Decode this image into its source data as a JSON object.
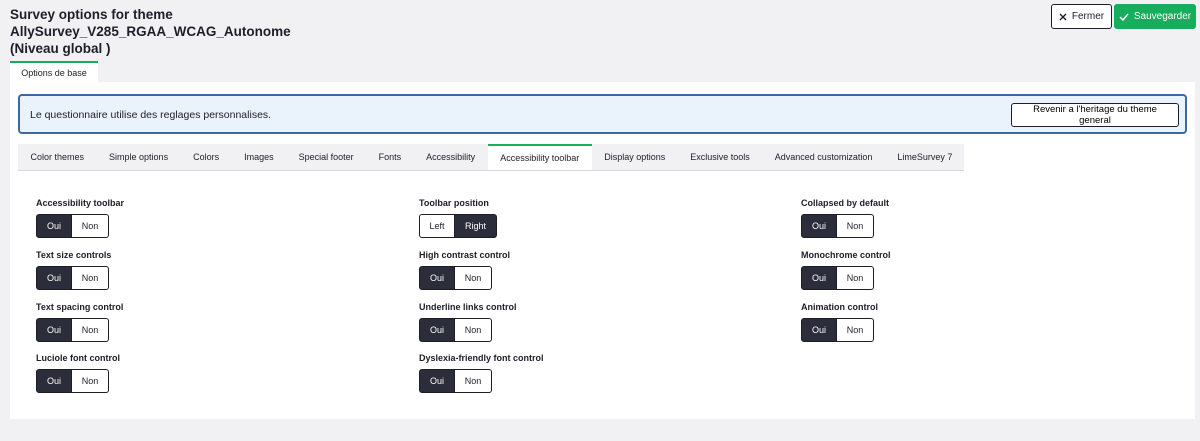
{
  "header": {
    "title_line1": "Survey options for theme",
    "title_line2": "AllySurvey_V285_RGAA_WCAG_Autonome",
    "title_line3": "(Niveau global )",
    "close_label": "Fermer",
    "save_label": "Sauvegarder"
  },
  "base_tab": "Options de base",
  "notice": {
    "text": "Le questionnaire utilise des reglages personnalises.",
    "revert_label": "Revenir a l'heritage du theme general"
  },
  "tabs": [
    {
      "label": "Color themes"
    },
    {
      "label": "Simple options"
    },
    {
      "label": "Colors"
    },
    {
      "label": "Images"
    },
    {
      "label": "Special footer"
    },
    {
      "label": "Fonts"
    },
    {
      "label": "Accessibility"
    },
    {
      "label": "Accessibility toolbar",
      "active": true
    },
    {
      "label": "Display options"
    },
    {
      "label": "Exclusive tools"
    },
    {
      "label": "Advanced customization"
    },
    {
      "label": "LimeSurvey 7"
    }
  ],
  "fields": {
    "accessibility_toolbar": {
      "label": "Accessibility toolbar",
      "options": [
        "Oui",
        "Non"
      ],
      "selected": "Oui"
    },
    "toolbar_position": {
      "label": "Toolbar position",
      "options": [
        "Left",
        "Right"
      ],
      "selected": "Right"
    },
    "collapsed_by_default": {
      "label": "Collapsed by default",
      "options": [
        "Oui",
        "Non"
      ],
      "selected": "Oui"
    },
    "text_size_controls": {
      "label": "Text size controls",
      "options": [
        "Oui",
        "Non"
      ],
      "selected": "Oui"
    },
    "high_contrast_control": {
      "label": "High contrast control",
      "options": [
        "Oui",
        "Non"
      ],
      "selected": "Oui"
    },
    "monochrome_control": {
      "label": "Monochrome control",
      "options": [
        "Oui",
        "Non"
      ],
      "selected": "Oui"
    },
    "text_spacing_control": {
      "label": "Text spacing control",
      "options": [
        "Oui",
        "Non"
      ],
      "selected": "Oui"
    },
    "underline_links_control": {
      "label": "Underline links control",
      "options": [
        "Oui",
        "Non"
      ],
      "selected": "Oui"
    },
    "animation_control": {
      "label": "Animation control",
      "options": [
        "Oui",
        "Non"
      ],
      "selected": "Oui"
    },
    "luciole_font_control": {
      "label": "Luciole font control",
      "options": [
        "Oui",
        "Non"
      ],
      "selected": "Oui"
    },
    "dyslexia_font_control": {
      "label": "Dyslexia-friendly font control",
      "options": [
        "Oui",
        "Non"
      ],
      "selected": "Oui"
    }
  },
  "colors": {
    "accent": "#14ae5c",
    "selected": "#2b2d3b",
    "notice_border": "#3b6aa0",
    "notice_bg": "#eaf2fc"
  }
}
